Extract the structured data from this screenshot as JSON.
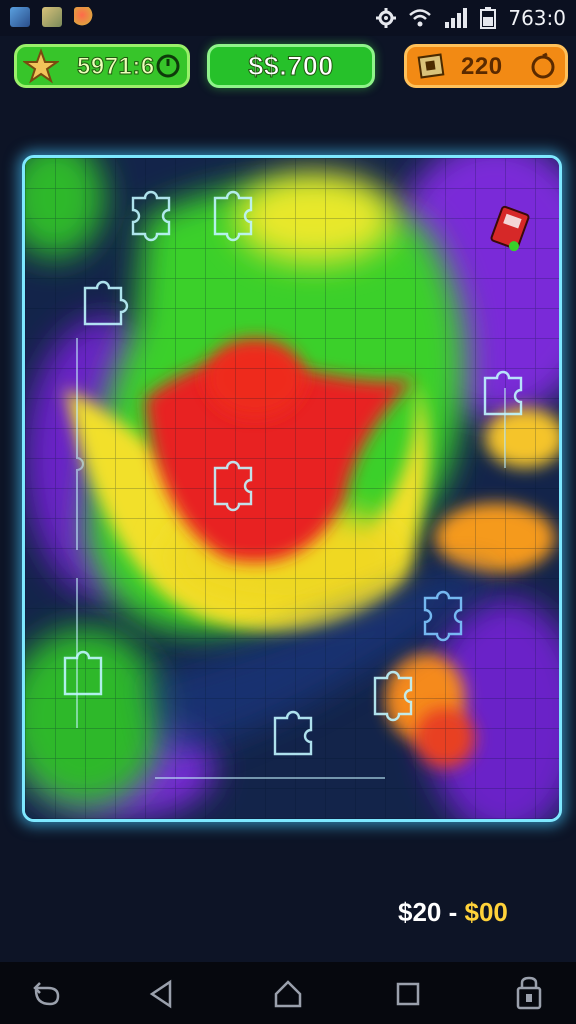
{
  "status_bar": {
    "time": "763:0",
    "icons": [
      "app-icon-photos",
      "app-icon-folder",
      "app-icon-game",
      "settings-icon",
      "wifi-icon",
      "signal-icon",
      "battery-icon"
    ]
  },
  "hud": {
    "stars": "5971:6",
    "coins": "$$.700",
    "pieces": "220"
  },
  "price": {
    "prefix": "$20 - ",
    "highlight": "$00"
  },
  "nav": {
    "items": [
      "back-icon",
      "triangle-back-icon",
      "home-icon",
      "recents-icon",
      "lock-icon"
    ]
  },
  "colors": {
    "board_border": "#7ee8ff",
    "stars_badge": "#37c52a",
    "coins_badge": "#26c12a",
    "pieces_badge": "#f28a14"
  }
}
